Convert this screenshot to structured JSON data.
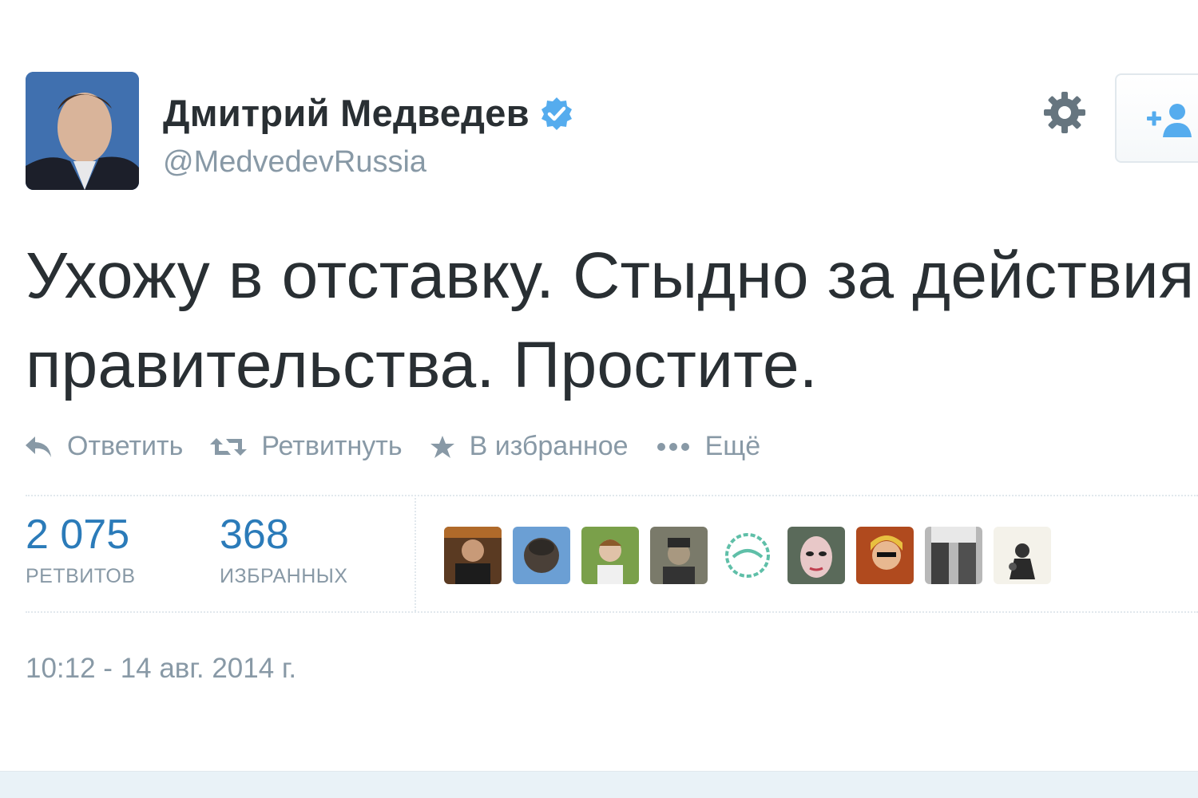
{
  "user": {
    "display_name": "Дмитрий Медведев",
    "handle": "@MedvedevRussia",
    "verified_icon": "verified-badge-icon"
  },
  "header": {
    "settings_icon": "gear-icon",
    "follow_icon": "follow-user-icon"
  },
  "tweet": {
    "line1": "Ухожу в отставку. Стыдно за действия",
    "line2": "правительства. Простите."
  },
  "actions": [
    {
      "label": "Ответить",
      "icon": "reply-icon"
    },
    {
      "label": "Ретвитнуть",
      "icon": "retweet-icon"
    },
    {
      "label": "В избранное",
      "icon": "star-icon"
    },
    {
      "label": "Ещё",
      "icon": "more-icon"
    }
  ],
  "stats": {
    "retweets": {
      "count": "2 075",
      "label": "РЕТВИТОВ"
    },
    "favorites": {
      "count": "368",
      "label": "ИЗБРАННЫХ"
    }
  },
  "timestamp": "10:12 - 14 авг. 2014 г.",
  "colors": {
    "link": "#2b7bb9",
    "muted": "#8899a6",
    "verified": "#55acee",
    "text": "#292f33"
  }
}
